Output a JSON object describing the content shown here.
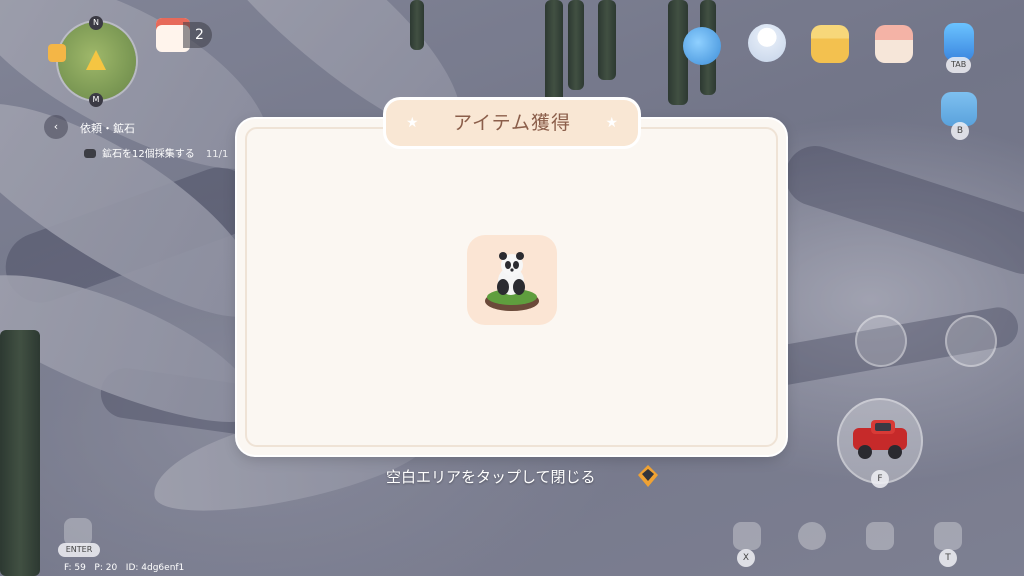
{
  "hud": {
    "compass": {
      "north": "N",
      "marker": "M"
    },
    "calendar": {
      "count": "2"
    },
    "quest": {
      "back_icon": "‹",
      "title": "依頼・鉱石",
      "task_prefix": "鉱石を",
      "task_number": "12",
      "task_suffix": "個採集する",
      "progress": "11/1"
    },
    "top_right": {
      "icons": [
        "planet-icon",
        "snowman-icon",
        "gift-box-icon",
        "basket-icon",
        "phone-icon",
        "backpack-icon"
      ],
      "tab_key": "TAB",
      "bag_key": "B"
    },
    "actions": {
      "car_key": "F",
      "x_key": "X",
      "t_key": "T"
    },
    "enter_key": "ENTER"
  },
  "dialog": {
    "title": "アイテム獲得",
    "star_left": "★",
    "star_right": "★",
    "item_icon": "panda-figurine-icon",
    "hint": "空白エリアをタップして閉じる"
  },
  "debug": {
    "f": "F: 59",
    "p": "P: 20",
    "id": "ID: 4dg6enf1"
  },
  "colors": {
    "dialog_bg": "#fbf7f2",
    "header_bg": "#f9e7d4",
    "title_text": "#8b5e4a",
    "item_card_bg": "#fbe5d4"
  }
}
